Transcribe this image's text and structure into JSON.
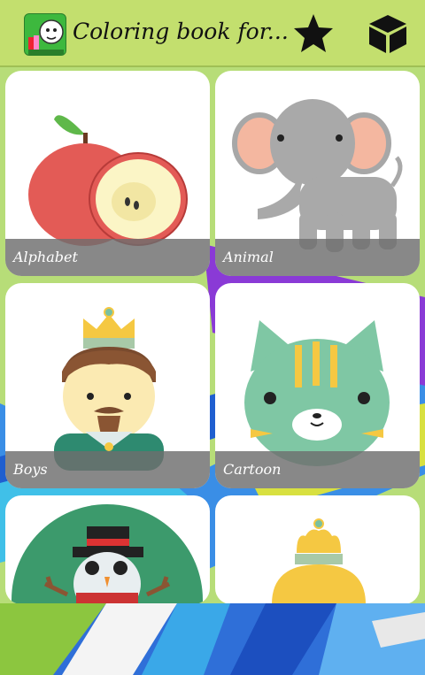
{
  "app_bar": {
    "title": "Coloring book for...",
    "icons": [
      "app-logo-icon",
      "star-icon",
      "box-icon"
    ]
  },
  "categories": [
    {
      "label": "Alphabet"
    },
    {
      "label": "Animal"
    },
    {
      "label": "Boys"
    },
    {
      "label": "Cartoon"
    },
    {
      "label": ""
    },
    {
      "label": ""
    }
  ],
  "colors": {
    "app_bar": "#c3df6e",
    "label_overlay": "#6e6e6e",
    "background": "#b9e07a"
  }
}
